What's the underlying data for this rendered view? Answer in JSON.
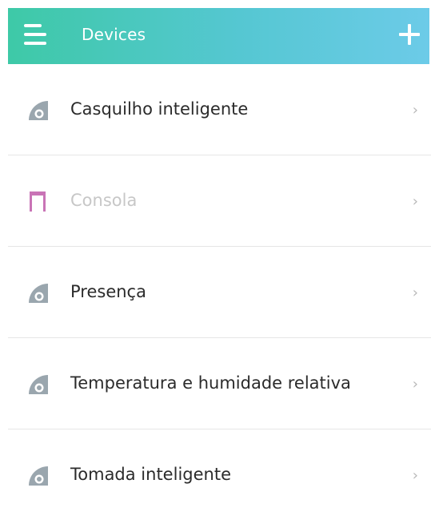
{
  "header": {
    "title": "Devices",
    "menu_icon": "hamburger-menu-icon",
    "add_icon": "plus-icon",
    "gradient_start": "#3ec9a7",
    "gradient_end": "#6ccbe8"
  },
  "devices": [
    {
      "label": "Casquilho inteligente",
      "icon": "device-generic-icon",
      "disabled": false,
      "chevron": "›"
    },
    {
      "label": "Consola",
      "icon": "console-device-icon",
      "disabled": true,
      "chevron": "›"
    },
    {
      "label": "Presença",
      "icon": "device-generic-icon",
      "disabled": false,
      "chevron": "›"
    },
    {
      "label": "Temperatura e humidade relativa",
      "icon": "device-generic-icon",
      "disabled": false,
      "chevron": "›"
    },
    {
      "label": "Tomada inteligente",
      "icon": "device-generic-icon",
      "disabled": false,
      "chevron": "›"
    }
  ],
  "colors": {
    "generic_icon": "#9aa6ae",
    "console_icon": "#c974b6",
    "divider": "#e6e6e6"
  }
}
